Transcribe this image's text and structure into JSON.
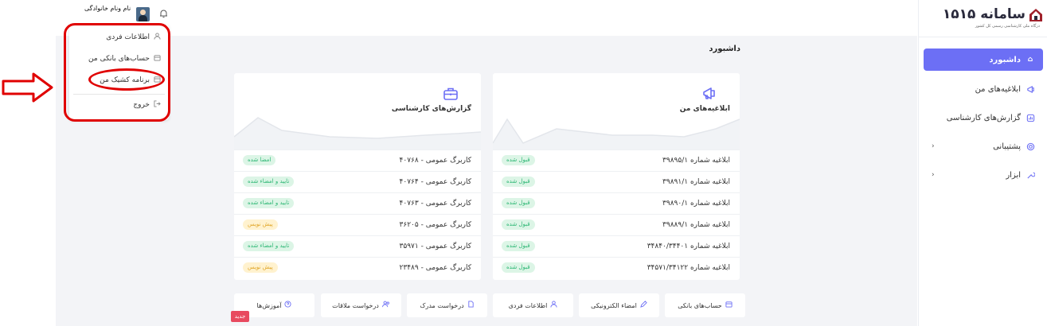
{
  "brand": {
    "name": "سامانه ۱۵۱۵",
    "subtitle": "درگاه ملی کارشناسی رسمی کل کشور",
    "color": "#2a2a3c"
  },
  "accent_color": "#6c6ff5",
  "header": {
    "username": "نام ونام خانوادگی",
    "icons": [
      "bell-icon",
      "avatar"
    ]
  },
  "user_menu": {
    "items": [
      {
        "label": "اطلاعات فردی",
        "icon": "user-icon"
      },
      {
        "label": "حساب‌های بانکی من",
        "icon": "calendar-icon"
      },
      {
        "label": "برنامه کشیک من",
        "icon": "calendar-icon"
      },
      {
        "label": "خروج",
        "icon": "logout-icon"
      }
    ]
  },
  "sidebar": {
    "items": [
      {
        "label": "داشبورد",
        "icon": "home-icon",
        "active": true
      },
      {
        "label": "ابلاغیه‌های من",
        "icon": "megaphone-icon"
      },
      {
        "label": "گزارش‌های کارشناسی",
        "icon": "report-icon"
      },
      {
        "label": "پشتیبانی",
        "icon": "support-icon",
        "expandable": true
      },
      {
        "label": "ابزار",
        "icon": "tool-icon",
        "expandable": true
      }
    ]
  },
  "page": {
    "title": "داشبورد"
  },
  "cards": {
    "notices": {
      "title": "ابلاغیه‌های من",
      "rows": [
        {
          "label": "ابلاغیه شماره ۳۹۸۹۵/۱",
          "status": "قبول شده",
          "tone": "green"
        },
        {
          "label": "ابلاغیه شماره ۳۹۸۹۱/۱",
          "status": "قبول شده",
          "tone": "green"
        },
        {
          "label": "ابلاغیه شماره ۳۹۸۹۰/۱",
          "status": "قبول شده",
          "tone": "green"
        },
        {
          "label": "ابلاغیه شماره ۳۹۸۸۹/۱",
          "status": "قبول شده",
          "tone": "green"
        },
        {
          "label": "ابلاغیه شماره ۳۴۸۴۰/۳۴۴۰۱",
          "status": "قبول شده",
          "tone": "green"
        },
        {
          "label": "ابلاغیه شماره ۳۴۵۷۱/۳۴۱۲۲",
          "status": "قبول شده",
          "tone": "green"
        }
      ]
    },
    "reports": {
      "title": "گزارش‌های کارشناسی",
      "rows": [
        {
          "label": "کاربرگ عمومی - ۴۰۷۶۸",
          "status": "امضا شده",
          "tone": "green"
        },
        {
          "label": "کاربرگ عمومی - ۴۰۷۶۴",
          "status": "تایید و امضاء شده",
          "tone": "green"
        },
        {
          "label": "کاربرگ عمومی - ۴۰۷۶۳",
          "status": "تایید و امضاء شده",
          "tone": "green"
        },
        {
          "label": "کاربرگ عمومی - ۳۶۲۰۵",
          "status": "پیش نویس",
          "tone": "yellow"
        },
        {
          "label": "کاربرگ عمومی - ۳۵۹۷۱",
          "status": "تایید و امضاء شده",
          "tone": "green"
        },
        {
          "label": "کاربرگ عمومی - ۲۳۴۸۹",
          "status": "پیش نویس",
          "tone": "yellow"
        }
      ]
    }
  },
  "quick_links": [
    {
      "label": "حساب‌های بانکی",
      "icon": "calendar-icon"
    },
    {
      "label": "امضاء الکترونیکی",
      "icon": "pen-icon"
    },
    {
      "label": "اطلاعات فردی",
      "icon": "user-icon"
    },
    {
      "label": "درخواست مدرک",
      "icon": "document-icon"
    },
    {
      "label": "درخواست ملاقات",
      "icon": "users-icon"
    },
    {
      "label": "آموزش‌ها",
      "icon": "help-icon"
    }
  ],
  "new_badge": "جدید"
}
